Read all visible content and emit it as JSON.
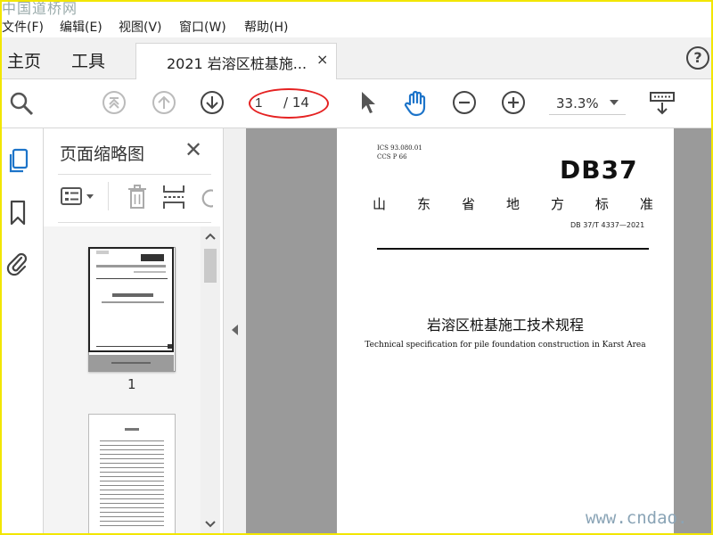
{
  "watermark_top": "中国道桥网",
  "watermark_bottom": "www.cndao.",
  "menu": [
    "文件(F)",
    "编辑(E)",
    "视图(V)",
    "窗口(W)",
    "帮助(H)"
  ],
  "tabs": {
    "home": "主页",
    "tools": "工具",
    "document": "2021 岩溶区桩基施...",
    "close_glyph": "×",
    "help_glyph": "?"
  },
  "toolbar": {
    "current_page": "1",
    "page_total": "/ 14",
    "zoom": "33.3%"
  },
  "thumbnails_panel": {
    "title": "页面缩略图",
    "close_glyph": "✕",
    "page_labels": [
      "1"
    ]
  },
  "document": {
    "ics": "ICS  93.080.01",
    "ccs": "CCS  P 66",
    "code": "DB37",
    "standard_type": [
      "山",
      "东",
      "省",
      "地",
      "方",
      "标",
      "准"
    ],
    "number": "DB 37/T  4337—2021",
    "title_cn": "岩溶区桩基施工技术规程",
    "title_en": "Technical specification for pile foundation construction in Karst Area"
  },
  "colors": {
    "highlight_oval": "#e52222",
    "frame": "#f2e600",
    "doc_background": "#9a9a9a"
  }
}
